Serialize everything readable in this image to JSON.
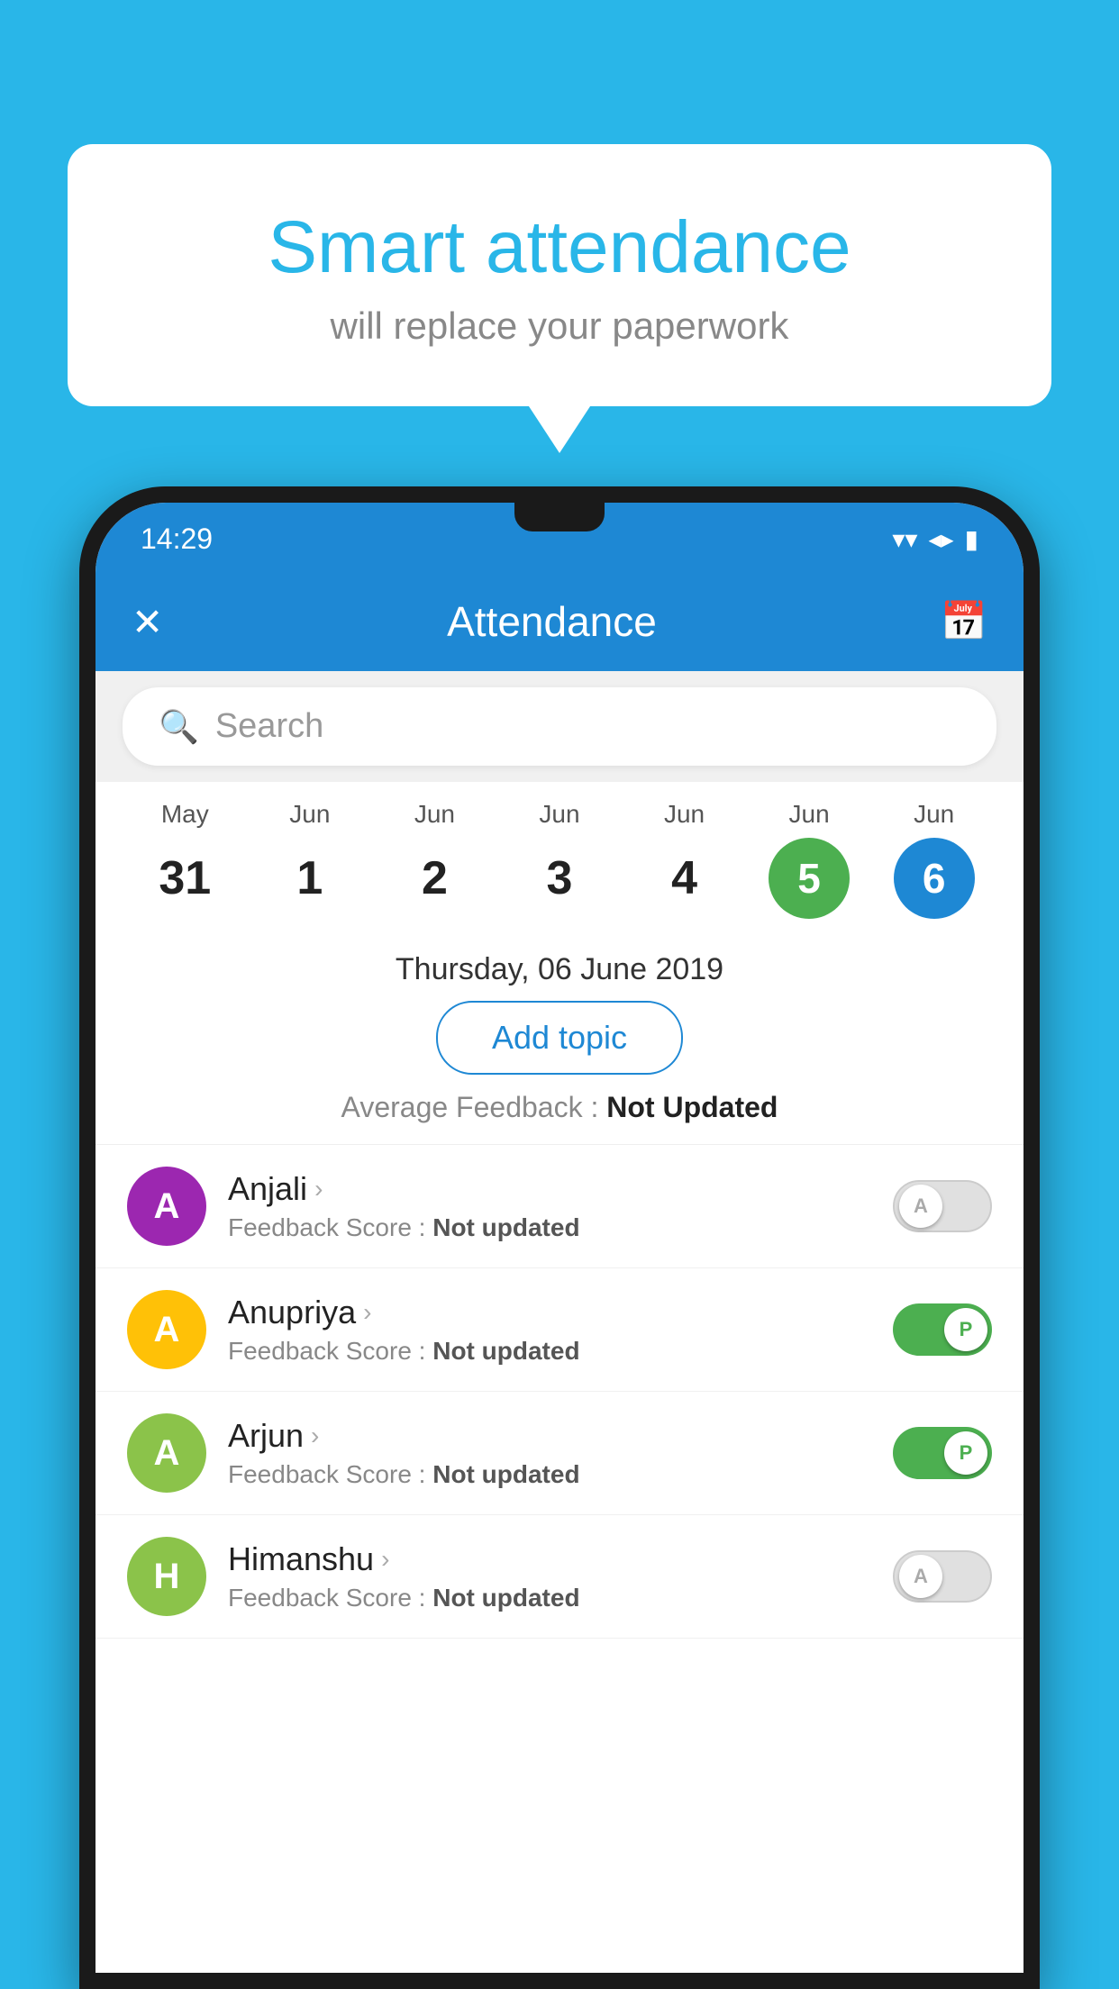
{
  "background_color": "#29B6E8",
  "bubble": {
    "title": "Smart attendance",
    "subtitle": "will replace your paperwork"
  },
  "status_bar": {
    "time": "14:29",
    "icons": [
      "▼",
      "◀",
      "▮"
    ]
  },
  "app_bar": {
    "title": "Attendance",
    "close_icon": "✕",
    "calendar_icon": "📅"
  },
  "search": {
    "placeholder": "Search"
  },
  "calendar": {
    "days": [
      {
        "month": "May",
        "date": "31",
        "state": "normal"
      },
      {
        "month": "Jun",
        "date": "1",
        "state": "normal"
      },
      {
        "month": "Jun",
        "date": "2",
        "state": "normal"
      },
      {
        "month": "Jun",
        "date": "3",
        "state": "normal"
      },
      {
        "month": "Jun",
        "date": "4",
        "state": "normal"
      },
      {
        "month": "Jun",
        "date": "5",
        "state": "today"
      },
      {
        "month": "Jun",
        "date": "6",
        "state": "selected"
      }
    ]
  },
  "selected_date": "Thursday, 06 June 2019",
  "add_topic_label": "Add topic",
  "avg_feedback_label": "Average Feedback : ",
  "avg_feedback_value": "Not Updated",
  "students": [
    {
      "name": "Anjali",
      "initial": "A",
      "avatar_color": "#9C27B0",
      "feedback": "Not updated",
      "toggle_state": "off"
    },
    {
      "name": "Anupriya",
      "initial": "A",
      "avatar_color": "#FFC107",
      "feedback": "Not updated",
      "toggle_state": "on"
    },
    {
      "name": "Arjun",
      "initial": "A",
      "avatar_color": "#8BC34A",
      "feedback": "Not updated",
      "toggle_state": "on"
    },
    {
      "name": "Himanshu",
      "initial": "H",
      "avatar_color": "#8BC34A",
      "feedback": "Not updated",
      "toggle_state": "off"
    }
  ],
  "toggle_labels": {
    "on": "P",
    "off": "A"
  },
  "feedback_prefix": "Feedback Score : "
}
